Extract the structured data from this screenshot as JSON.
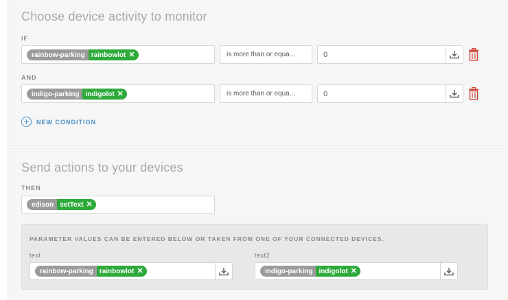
{
  "monitor": {
    "title": "Choose device activity to monitor",
    "new_condition_label": "NEW CONDITION",
    "conditions": [
      {
        "label": "IF",
        "device": "rainbow-parking",
        "value": "rainbowlot",
        "operator": "is more than or equa...",
        "threshold": "0"
      },
      {
        "label": "AND",
        "device": "indigo-parking",
        "value": "indigolot",
        "operator": "is more than or equa...",
        "threshold": "0"
      }
    ]
  },
  "actions": {
    "title": "Send actions to your devices",
    "then_label": "THEN",
    "device": "edison",
    "action": "setText",
    "param_notice": "PARAMETER VALUES CAN BE ENTERED BELOW OR TAKEN FROM ONE OF YOUR CONNECTED DEVICES.",
    "params": [
      {
        "name": "text",
        "device": "rainbow-parking",
        "value": "rainbowlot"
      },
      {
        "name": "text2",
        "device": "indigo-parking",
        "value": "indigolot"
      }
    ]
  },
  "colors": {
    "accent": "#4a90c8",
    "pill_value": "#2eaa3b",
    "pill_device": "#9b9b9b",
    "delete": "#d0453a"
  },
  "icons": {
    "remove": "close-icon",
    "import": "download-icon",
    "delete": "trash-icon",
    "add": "plus-circle-icon"
  }
}
